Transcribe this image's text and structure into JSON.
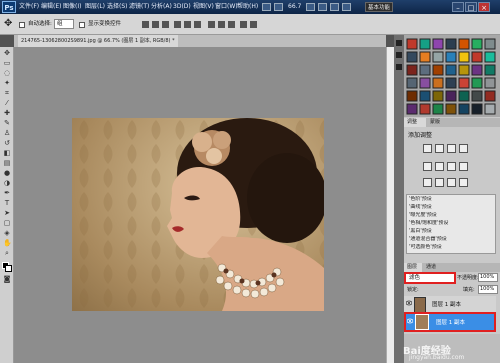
{
  "app": {
    "logo_text": "Ps"
  },
  "menu": [
    "文件(F)",
    "编辑(E)",
    "图像(I)",
    "图层(L)",
    "选择(S)",
    "滤镜(T)",
    "分析(A)",
    "3D(D)",
    "视图(V)",
    "窗口(W)",
    "帮助(H)"
  ],
  "titlebar": {
    "zoom": "66.7",
    "workspace": "基本功能",
    "min": "–",
    "max": "□",
    "close": "×"
  },
  "options_bar": {
    "auto_select_label": "自动选择:",
    "auto_select_value": "组",
    "show_transform": "显示变换控件"
  },
  "document_tab": {
    "title": "214765-130628002S9891.jpg @ 66.7% (图层 1 副本, RGB/8) *"
  },
  "panels": {
    "tab_adjust": "调整",
    "tab_mask": "蒙版",
    "adjust_title": "添加调整",
    "presets": [
      "'色阶'预设",
      "'曲线'预设",
      "'曝光度'预设",
      "'色相/饱和度'预设",
      "'黑白'预设",
      "'通道混合器'预设",
      "'可选颜色'预设"
    ],
    "tab_layers": "图层",
    "tab_channels": "通道",
    "blend_mode": "滤色",
    "opacity_label": "不透明度:",
    "opacity_value": "100%",
    "lock_label": "锁定:",
    "fill_label": "填充:",
    "fill_value": "100%",
    "layers": [
      {
        "name": "图层 1 副本",
        "selected": false
      },
      {
        "name": "图层 1 副本",
        "selected": true
      }
    ]
  },
  "watermark": {
    "title": "Bai度经验",
    "url": "jingyan.baidu.com"
  },
  "colors": {
    "accent": "#3a8ee6",
    "highlight": "#e02020",
    "titlebar": "#163459"
  }
}
